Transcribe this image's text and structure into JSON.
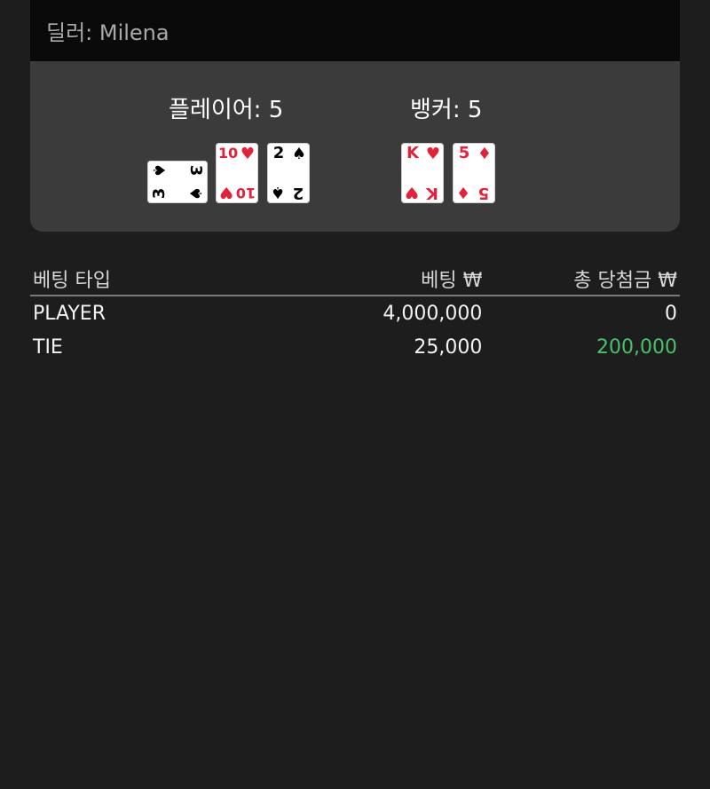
{
  "dealer": {
    "label": "딜러: Milena"
  },
  "player": {
    "title": "플레이어: 5",
    "cards": [
      {
        "rank": "3",
        "suit": "♠",
        "color": "#000000"
      },
      {
        "rank": "10",
        "suit": "♥",
        "color": "#e5213a"
      },
      {
        "rank": "2",
        "suit": "♠",
        "color": "#000000"
      }
    ]
  },
  "banker": {
    "title": "뱅커: 5",
    "cards": [
      {
        "rank": "K",
        "suit": "♥",
        "color": "#e5213a"
      },
      {
        "rank": "5",
        "suit": "♦",
        "color": "#e5213a"
      }
    ]
  },
  "table": {
    "headers": [
      "베팅 타입",
      "베팅 ₩",
      "총 당첨금 ₩"
    ],
    "rows": [
      {
        "type": "PLAYER",
        "bet": "4,000,000",
        "payout": "0"
      },
      {
        "type": "TIE",
        "bet": "25,000",
        "payout": "200,000"
      }
    ]
  },
  "colors": {
    "win": "#49c16b",
    "panel": "#3b3b3b",
    "background": "#1d1d1d"
  }
}
